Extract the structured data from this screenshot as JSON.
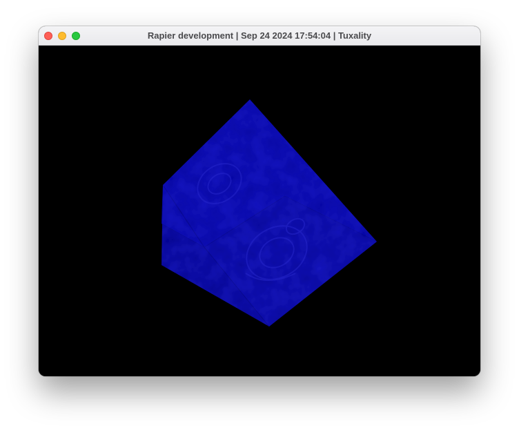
{
  "window": {
    "title": "Rapier development | Sep 24 2024 17:54:04 | Tuxality"
  },
  "traffic_lights": {
    "close_color": "#fe5f57",
    "minimize_color": "#febc2e",
    "zoom_color": "#28c840"
  },
  "viewport": {
    "background_color": "#000000",
    "object": "textured-cube",
    "cube_color": "#0a0a9e"
  }
}
